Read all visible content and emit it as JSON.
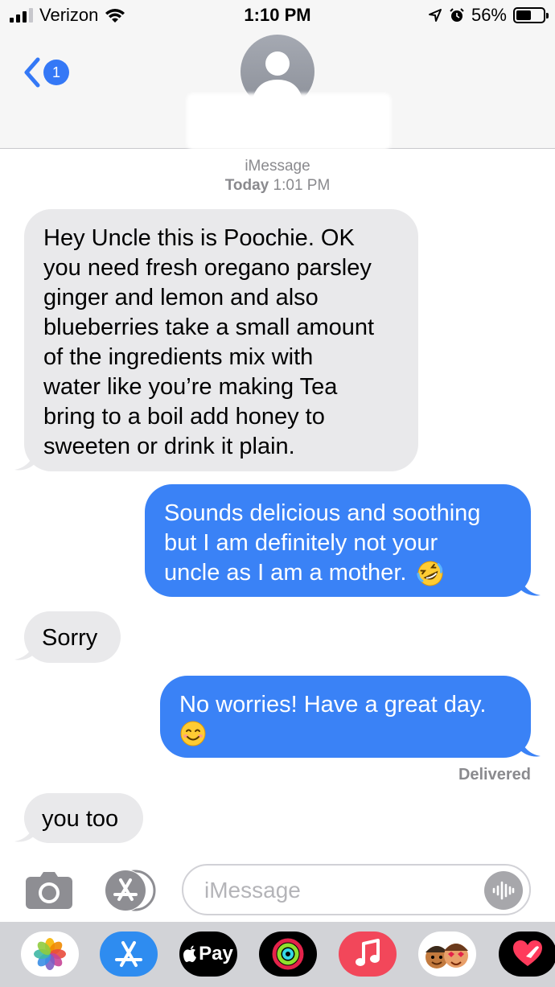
{
  "status_bar": {
    "carrier": "Verizon",
    "time": "1:10 PM",
    "battery_percent": "56%",
    "battery_level": 0.56,
    "icons": [
      "signal-icon",
      "wifi-icon",
      "location-arrow-icon",
      "alarm-icon",
      "battery-icon"
    ]
  },
  "header": {
    "back_badge": "1",
    "contact_name": ""
  },
  "thread": {
    "service": "iMessage",
    "timestamp_day": "Today",
    "timestamp_time": "1:01 PM",
    "delivered": "Delivered",
    "messages": [
      {
        "direction": "incoming",
        "lines": [
          "Hey Uncle this is Poochie. OK",
          "you need fresh oregano parsley",
          "ginger and lemon and also",
          "blueberries take a small amount",
          "of the  ingredients mix with",
          "water like you’re making Tea",
          "bring to a boil add honey to",
          "sweeten or drink it plain."
        ]
      },
      {
        "direction": "outgoing",
        "lines": [
          "Sounds delicious and soothing",
          "but I am definitely not your",
          "uncle as I am a mother."
        ],
        "emoji": "rolling-on-floor-laughing"
      },
      {
        "direction": "incoming",
        "text": "Sorry"
      },
      {
        "direction": "outgoing",
        "lines": [
          "No worries! Have a great day."
        ],
        "emoji": "smiling-face"
      },
      {
        "direction": "incoming",
        "text": "you too"
      }
    ]
  },
  "compose": {
    "placeholder": "iMessage",
    "value": ""
  },
  "drawer": {
    "apps": [
      "photos-icon",
      "app-store-icon",
      "apple-pay-icon",
      "activity-icon",
      "music-icon",
      "memoji-icon",
      "digital-touch-icon"
    ],
    "apple_pay_label": "Pay"
  },
  "colors": {
    "outgoing_bubble": "#3a82f6",
    "incoming_bubble": "#e9e9eb",
    "ios_blue": "#3478f6",
    "header_bg": "#f6f6f6",
    "drawer_bg": "#d2d3d7"
  }
}
